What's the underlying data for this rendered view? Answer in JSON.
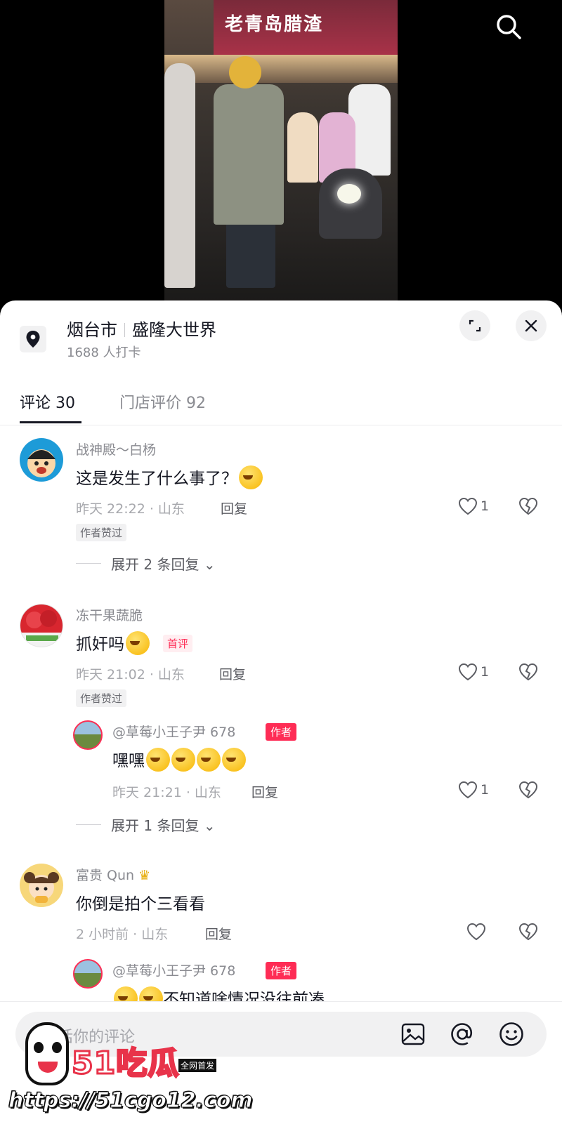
{
  "location": {
    "city": "烟台市",
    "place": "盛隆大世界",
    "checkins": "1688 人打卡"
  },
  "tabs": [
    {
      "label": "评论 30"
    },
    {
      "label": "门店评价 92"
    }
  ],
  "comments": [
    {
      "name": "战神殿～白杨",
      "text": "这是发生了什么事了？",
      "meta": "昨天 22:22 · 山东",
      "reply": "回复",
      "likes": "1",
      "badge": "作者赞过",
      "expand": "展开 2 条回复"
    },
    {
      "name": "冻干果蔬脆",
      "text": "抓奸吗",
      "tag": "首评",
      "meta": "昨天 21:02 · 山东",
      "reply": "回复",
      "likes": "1",
      "badge": "作者赞过",
      "subreply": {
        "name": "@草莓小王子尹 678",
        "tag": "作者",
        "text": "嘿嘿",
        "meta": "昨天 21:21 · 山东",
        "reply": "回复",
        "likes": "1"
      },
      "expand": "展开 1 条回复"
    },
    {
      "name": "富贵 Qun",
      "text": "你倒是拍个三看看",
      "meta": "2 小时前 · 山东",
      "reply": "回复",
      "likes": "",
      "subreply": {
        "name": "@草莓小王子尹 678",
        "tag": "作者",
        "text": "不知道啥情况没往前凑"
      }
    }
  ],
  "input": {
    "placeholder": "有话你的评论"
  },
  "video": {
    "store_sign": "老青岛腊渣"
  },
  "watermark": {
    "logo": "51吃瓜",
    "tag": "全网首发",
    "url": "https://51cgo12.com"
  },
  "colors": {
    "accent": "#fe2c55",
    "text_primary": "#161823",
    "text_secondary": "#8a8b91"
  }
}
